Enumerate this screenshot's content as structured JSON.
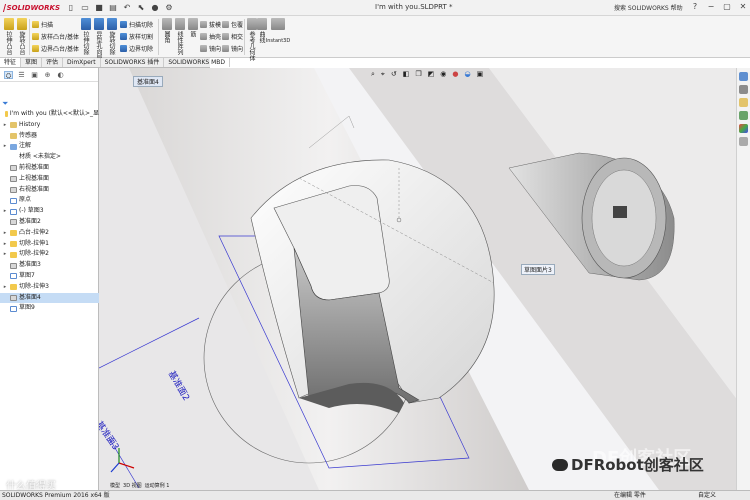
{
  "app": {
    "logo_text": "SOLIDWORKS",
    "document_title": "I'm with you.SLDPRT *",
    "search_text": "搜索 SOLIDWORKS 帮助",
    "window_controls": [
      "?",
      "−",
      "▢",
      "✕"
    ]
  },
  "quick_access": [
    "new-icon",
    "open-icon",
    "save-icon",
    "print-icon",
    "undo-icon",
    "select-icon",
    "rebuild-icon",
    "options-icon"
  ],
  "ribbon": {
    "big_tools": [
      {
        "label": "拉伸凸台",
        "icon": "extrude-boss-icon"
      },
      {
        "label": "旋转凸台",
        "icon": "revolve-boss-icon"
      },
      {
        "label": "拉伸切除",
        "icon": "extrude-cut-icon"
      },
      {
        "label": "异型孔向导",
        "icon": "hole-wizard-icon"
      },
      {
        "label": "旋转切除",
        "icon": "revolve-cut-icon"
      }
    ],
    "row_tools_a": [
      "扫描",
      "放样凸台/基体",
      "边界凸台/基体"
    ],
    "row_tools_b": [
      "扫描切除",
      "放样切割",
      "边界切除"
    ],
    "mid_big": [
      {
        "label": "圆角",
        "icon": "fillet-icon"
      },
      {
        "label": "线性阵列",
        "icon": "linear-pattern-icon"
      },
      {
        "label": "筋",
        "icon": "rib-icon"
      }
    ],
    "row_tools_c": [
      "拔模",
      "抽壳",
      "镜向"
    ],
    "row_tools_d": [
      "包覆",
      "相交",
      "镜向"
    ],
    "ref_big": [
      {
        "label": "参考几何体",
        "icon": "reference-geometry-icon"
      },
      {
        "label": "曲线",
        "icon": "curves-icon"
      }
    ],
    "instant3d": "Instant3D"
  },
  "command_tabs": [
    "特征",
    "草图",
    "评估",
    "DimXpert",
    "SOLIDWORKS 插件",
    "SOLIDWORKS MBD"
  ],
  "active_command_tab": 0,
  "panel_tabs": [
    "feature-manager-icon",
    "property-manager-icon",
    "configuration-manager-icon",
    "dimxpert-icon",
    "display-manager-icon"
  ],
  "tree": [
    {
      "label": "I'm with you  (默认<<默认>_显",
      "indent": 0,
      "arrow": "",
      "icon": "part-icon",
      "cls": "ni-feat"
    },
    {
      "label": "History",
      "indent": 1,
      "arrow": "▸",
      "icon": "history-icon",
      "cls": "ni-folder"
    },
    {
      "label": "传感器",
      "indent": 1,
      "arrow": "",
      "icon": "sensor-icon",
      "cls": "ni-folder"
    },
    {
      "label": "注解",
      "indent": 1,
      "arrow": "▸",
      "icon": "annotation-icon",
      "cls": "ni-note"
    },
    {
      "label": "材质 <未指定>",
      "indent": 1,
      "arrow": "",
      "icon": "material-icon",
      "cls": "ni-gry"
    },
    {
      "label": "前视基准面",
      "indent": 1,
      "arrow": "",
      "icon": "plane-icon",
      "cls": "ni-plane"
    },
    {
      "label": "上视基准面",
      "indent": 1,
      "arrow": "",
      "icon": "plane-icon",
      "cls": "ni-plane"
    },
    {
      "label": "右视基准面",
      "indent": 1,
      "arrow": "",
      "icon": "plane-icon",
      "cls": "ni-plane"
    },
    {
      "label": "原点",
      "indent": 1,
      "arrow": "",
      "icon": "origin-icon",
      "cls": "ni-sketch"
    },
    {
      "label": "(-) 草图3",
      "indent": 1,
      "arrow": "▸",
      "icon": "sketch-icon",
      "cls": "ni-sketch"
    },
    {
      "label": "基准面2",
      "indent": 1,
      "arrow": "",
      "icon": "plane-icon",
      "cls": "ni-plane"
    },
    {
      "label": "凸台-拉伸2",
      "indent": 1,
      "arrow": "▸",
      "icon": "extrude-icon",
      "cls": "ni-feat"
    },
    {
      "label": "切除-拉伸1",
      "indent": 1,
      "arrow": "▸",
      "icon": "cut-extrude-icon",
      "cls": "ni-feat"
    },
    {
      "label": "切除-拉伸2",
      "indent": 1,
      "arrow": "▸",
      "icon": "cut-extrude-icon",
      "cls": "ni-feat"
    },
    {
      "label": "基准面3",
      "indent": 1,
      "arrow": "",
      "icon": "plane-icon",
      "cls": "ni-plane"
    },
    {
      "label": "草图7",
      "indent": 1,
      "arrow": "",
      "icon": "sketch-icon",
      "cls": "ni-sketch"
    },
    {
      "label": "切除-拉伸3",
      "indent": 1,
      "arrow": "▸",
      "icon": "cut-extrude-icon",
      "cls": "ni-feat"
    },
    {
      "label": "基准面4",
      "indent": 1,
      "arrow": "",
      "icon": "plane-icon",
      "cls": "ni-plane",
      "selected": true
    },
    {
      "label": "草图9",
      "indent": 1,
      "arrow": "",
      "icon": "sketch-icon",
      "cls": "ni-sketch"
    }
  ],
  "viewport": {
    "tag_plane4": "基准面4",
    "tag_plane3_face": "草图面片3",
    "label_plane2": "基准面2",
    "label_plane3": "基准面3",
    "heads_up_icons": [
      "zoom-fit-icon",
      "zoom-area-icon",
      "previous-view-icon",
      "section-view-icon",
      "view-orientation-icon",
      "display-style-icon",
      "hide-show-icon",
      "edit-appearance-icon",
      "apply-scene-icon",
      "view-settings-icon"
    ]
  },
  "task_pane_icons": [
    "resources-icon",
    "design-library-icon",
    "file-explorer-icon",
    "view-palette-icon",
    "appearances-icon",
    "custom-properties-icon"
  ],
  "status": {
    "left": "SOLIDWORKS Premium 2016 x64 版",
    "r1": "在编辑 零件",
    "r2": "",
    "r3": "自定义"
  },
  "bottom_tabs": [
    "模型",
    "3D 视图",
    "运动算例 1"
  ],
  "watermarks": {
    "left": "什么值得买",
    "right": "DFRobot创客社区",
    "bg": "DF创客社区"
  },
  "colors": {
    "accent": "#3a7bd5",
    "selection": "#c5dcf5",
    "brand_red": "#c8102e"
  }
}
